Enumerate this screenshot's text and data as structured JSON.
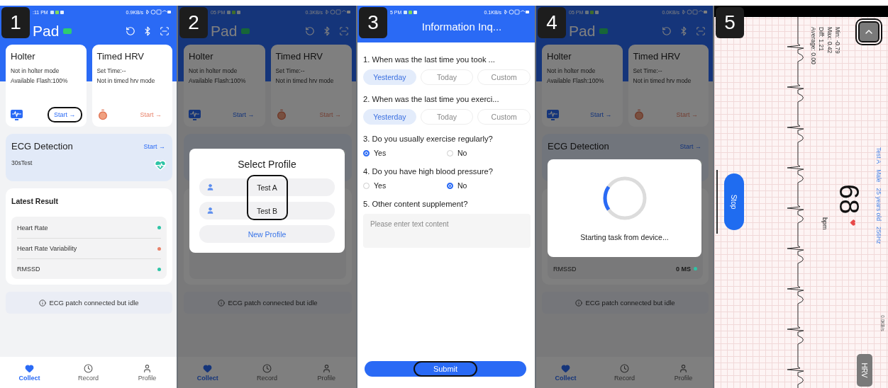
{
  "panels": [
    {
      "kind": "home",
      "badge": "1",
      "status": {
        "time": ":11 PM",
        "speed": "0.9KB/s"
      },
      "title": "Pad",
      "cards": [
        {
          "kind": "holter",
          "title": "Holter",
          "lines": [
            "Not in holter mode",
            "Available Flash:100%"
          ],
          "action": "Start →",
          "highlighted": true
        },
        {
          "kind": "timer",
          "title": "Timed HRV",
          "lines": [
            "Set Time:--",
            "Not in timed hrv mode"
          ],
          "action": "Start →",
          "highlighted": false
        }
      ],
      "ecg": {
        "title": "ECG Detection",
        "action": "Start →",
        "subtitle": "30sTest"
      },
      "results": {
        "title": "Latest Result",
        "rows": [
          {
            "label": "Heart Rate",
            "color": "#2ec4a6"
          },
          {
            "label": "Heart Rate Variability",
            "color": "#e8826a"
          },
          {
            "label": "RMSSD",
            "color": "#2ec4a6"
          }
        ]
      },
      "notice": "ECG patch connected but idle",
      "nav": [
        {
          "label": "Collect",
          "selected": true
        },
        {
          "label": "Record",
          "selected": false
        },
        {
          "label": "Profile",
          "selected": false
        }
      ]
    },
    {
      "kind": "home",
      "badge": "2",
      "status": {
        "time": "05 PM",
        "speed": "0.3KB/s"
      },
      "title": "Pad",
      "dimmed": true,
      "cards": [
        {
          "kind": "holter",
          "title": "Holter",
          "lines": [
            "Not in holter mode",
            "Available Flash:100%"
          ],
          "action": "Start →",
          "highlighted": false
        },
        {
          "kind": "timer",
          "title": "Timed HRV",
          "lines": [
            "Set Time:--",
            "Not in timed hrv mode"
          ],
          "action": "Start →",
          "highlighted": false
        }
      ],
      "notice": "ECG patch connected but idle",
      "nav": [
        {
          "label": "Collect",
          "selected": true
        },
        {
          "label": "Record",
          "selected": false
        },
        {
          "label": "Profile",
          "selected": false
        }
      ],
      "dialog": {
        "kind": "profile_select",
        "title": "Select Profile",
        "profiles": [
          "Test A",
          "Test B"
        ],
        "names_highlighted": true,
        "new_label": "New Profile"
      }
    },
    {
      "kind": "questionnaire",
      "badge": "3",
      "status": {
        "time": "5 PM",
        "speed": "0.1KB/s"
      },
      "title": "Information Inq...",
      "questions": [
        {
          "kind": "choice",
          "text": "1. When was the last time you took ...",
          "options": [
            {
              "label": "Yesterday",
              "selected": true
            },
            {
              "label": "Today",
              "selected": false
            },
            {
              "label": "Custom",
              "selected": false
            }
          ]
        },
        {
          "kind": "choice",
          "text": "2. When was the last time you exerci...",
          "options": [
            {
              "label": "Yesterday",
              "selected": true
            },
            {
              "label": "Today",
              "selected": false
            },
            {
              "label": "Custom",
              "selected": false
            }
          ]
        },
        {
          "kind": "radio",
          "text": "3. Do you usually exercise regularly?",
          "options": [
            {
              "label": "Yes",
              "selected": true
            },
            {
              "label": "No",
              "selected": false
            }
          ]
        },
        {
          "kind": "radio",
          "text": "4. Do you have high blood pressure?",
          "options": [
            {
              "label": "Yes",
              "selected": false
            },
            {
              "label": "No",
              "selected": true
            }
          ]
        },
        {
          "kind": "text",
          "text": "5. Other content supplement?",
          "placeholder": "Please enter text content"
        }
      ],
      "submit": {
        "label": "Submit",
        "highlighted": true
      }
    },
    {
      "kind": "home",
      "badge": "4",
      "status": {
        "time": "05 PM",
        "speed": "0.0KB/s"
      },
      "title": "Pad",
      "dimmed": true,
      "cards": [
        {
          "kind": "holter",
          "title": "Holter",
          "lines": [
            "Not in holter mode",
            "Available Flash:100%"
          ],
          "action": "Start →",
          "highlighted": false
        },
        {
          "kind": "timer",
          "title": "Timed HRV",
          "lines": [
            "Set Time:--",
            "Not in timed hrv mode"
          ],
          "action": "Start →",
          "highlighted": false
        }
      ],
      "ecg": {
        "title": "ECG Detection",
        "action": "Start →"
      },
      "results": {
        "rows": [
          {
            "label": "RMSSD",
            "value": "0 MS",
            "color": "#2ec4a6"
          }
        ]
      },
      "notice": "ECG patch connected but idle",
      "nav": [
        {
          "label": "Collect",
          "selected": true
        },
        {
          "label": "Record",
          "selected": false
        },
        {
          "label": "Profile",
          "selected": false
        }
      ],
      "dialog": {
        "kind": "loading",
        "message": "Starting task from device..."
      }
    },
    {
      "kind": "ecg_live",
      "badge": "5",
      "speed": "0.0KB/s",
      "stats": [
        "Min: -0.79",
        "Max: 0.42",
        "Diff: 1.21",
        "Average: 0.00"
      ],
      "patient": [
        "Test A",
        "Male",
        "25 years old",
        "256Hz"
      ],
      "bpm": "68",
      "bpm_unit": "bpm",
      "stop": "Stop",
      "hrv": "HRV",
      "collapse_highlighted": true
    }
  ]
}
